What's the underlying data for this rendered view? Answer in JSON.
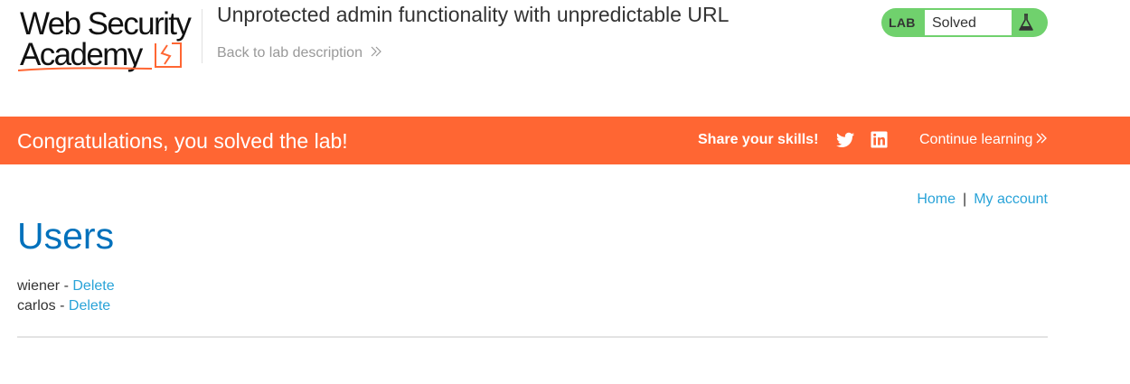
{
  "logo": {
    "line1": "Web Security",
    "line2": "Academy",
    "accent_color": "#ff6633"
  },
  "header": {
    "lab_title": "Unprotected admin functionality with unpredictable URL",
    "back_link": "Back to lab description",
    "back_icon": "double-chevron-right-icon"
  },
  "lab_status": {
    "tag": "LAB",
    "status": "Solved",
    "status_color": "#70d16d",
    "icon": "flask-icon"
  },
  "banner": {
    "message": "Congratulations, you solved the lab!",
    "share_label": "Share your skills!",
    "share_icons": [
      "twitter-icon",
      "linkedin-icon"
    ],
    "continue_label": "Continue learning",
    "background": "#ff6633"
  },
  "nav": {
    "home": "Home",
    "separator": "|",
    "my_account": "My account"
  },
  "main": {
    "heading": "Users",
    "users": [
      {
        "name": "wiener",
        "separator": " - ",
        "action": "Delete"
      },
      {
        "name": "carlos",
        "separator": " - ",
        "action": "Delete"
      }
    ]
  }
}
